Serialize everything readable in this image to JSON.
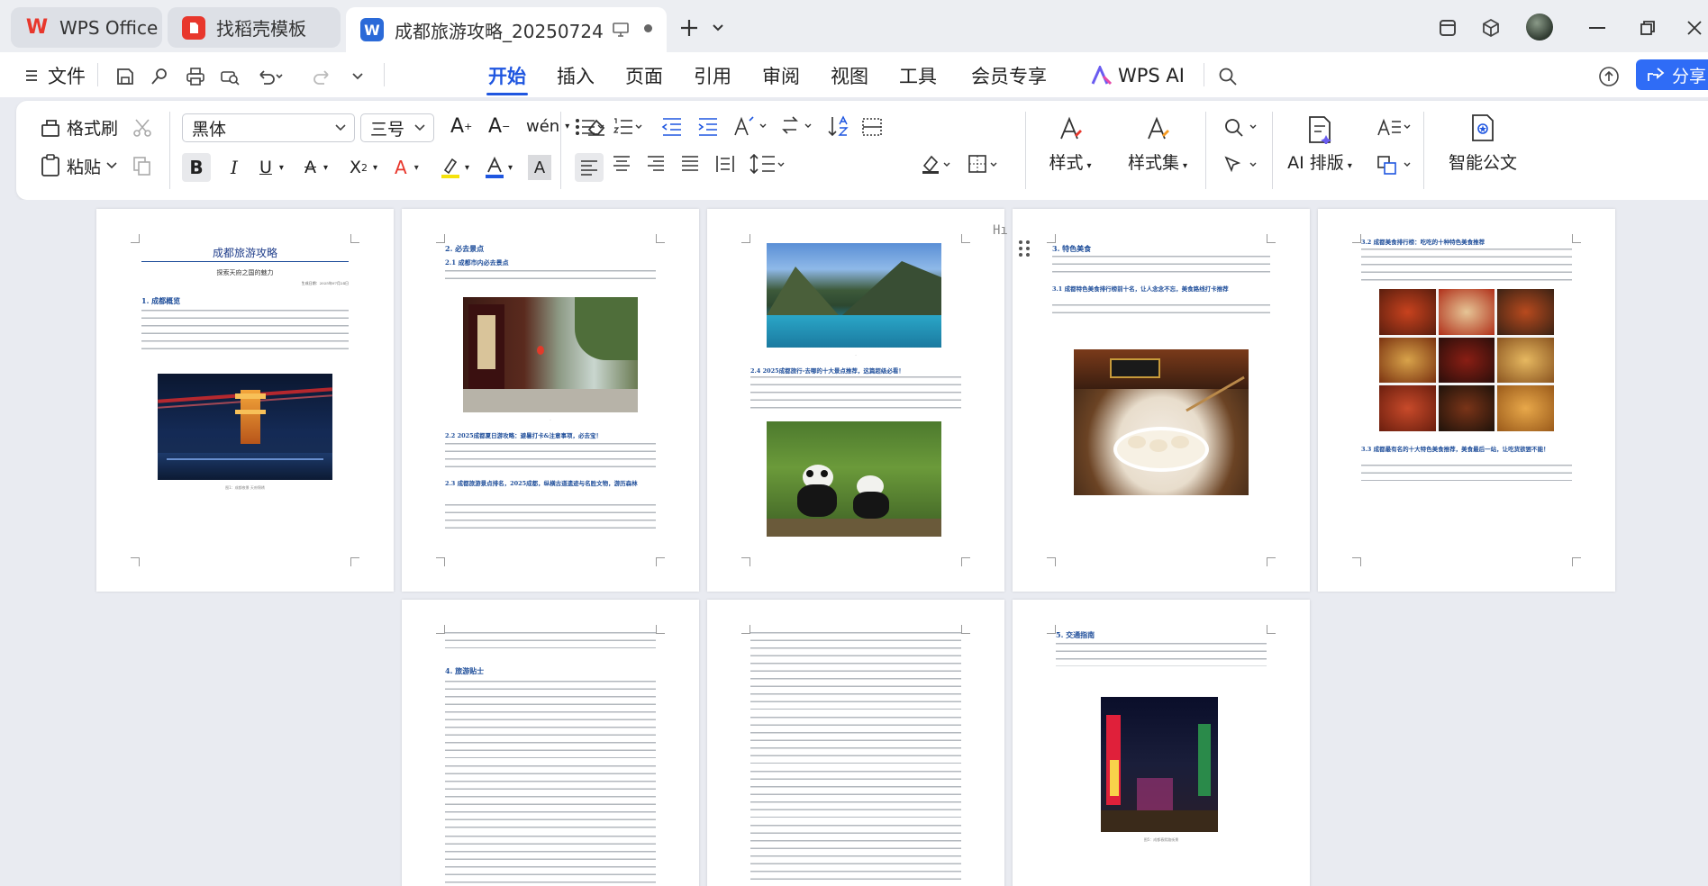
{
  "tabs": [
    {
      "label": "WPS Office",
      "icon": "wps-logo-icon",
      "color": "#e8372c"
    },
    {
      "label": "找稻壳模板",
      "icon": "docer-icon",
      "color": "#e8372c"
    },
    {
      "label": "成都旅游攻略_20250724.docx",
      "icon": "word-doc-icon",
      "color": "#2b6ad8"
    }
  ],
  "menu": {
    "file": "文件",
    "items": [
      "开始",
      "插入",
      "页面",
      "引用",
      "审阅",
      "视图",
      "工具",
      "会员专享"
    ],
    "wps_ai": "WPS AI",
    "share": "分享"
  },
  "ribbon": {
    "format_painter": "格式刷",
    "paste": "粘贴",
    "font_name": "黑体",
    "font_size": "三号",
    "styles": "样式",
    "style_set": "样式集",
    "ai_layout": "AI 排版",
    "smart_doc": "智能公文"
  },
  "pages": {
    "p1": {
      "title": "成都旅游攻略",
      "subtitle": "探索天府之国的魅力",
      "date": "生成日期：2025年07月24日",
      "h1": "1. 成都概览",
      "cap": "图1：成都夜景 天府锦绣"
    },
    "p2": {
      "h1": "2. 必去景点",
      "h2": "2.1 成都市内必去景点",
      "h3": "2.2 2025成都夏日游攻略：避暑打卡&注意事项，必去宝！",
      "h4": "2.3 成都旅游景点排名，2025成都，纵横古道遗迹与名胜文物，游历森林"
    },
    "p3": {
      "h1": "2.4 2025成都旅行-去哪的十大景点推荐，这篇超级必看！"
    },
    "p4": {
      "h1": "3. 特色美食",
      "h2": "3.1 成都特色美食排行榜前十名，让人念念不忘，美食路线打卡推荐"
    },
    "p5": {
      "h1": "3.2 成都美食排行榜：吃吃的十种特色美食推荐",
      "h2": "3.3 成都最有名的十大特色美食推荐，美食最后一站，让吃货欲罢不能！"
    },
    "p6": {
      "h1": "4. 旅游贴士"
    },
    "p8": {
      "h1": "5. 交通指南",
      "cap": "图5：成都春熙路街景"
    }
  }
}
